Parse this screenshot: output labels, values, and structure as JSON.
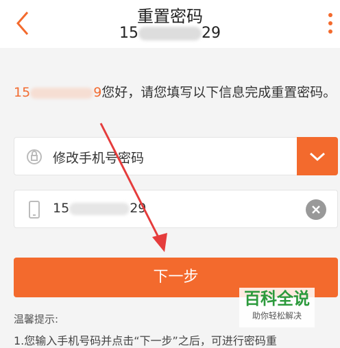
{
  "header": {
    "title": "重置密码",
    "phone_masked": "15 ██████ 29"
  },
  "greeting": {
    "phone_prefix": "15",
    "phone_suffix": "9",
    "text": "您好，请您填写以下信息完成重置密码。"
  },
  "dropdown": {
    "value": "修改手机号密码"
  },
  "phone_input": {
    "value_prefix": "15",
    "value_suffix": "29"
  },
  "next_button": {
    "label": "下一步"
  },
  "tips": {
    "title": "温馨提示:",
    "line1": "1.您输入手机号码并点击“下一步”之后，可进行密码重"
  },
  "watermark": {
    "main": "百科全说",
    "sub": "助你轻松解决"
  },
  "colors": {
    "accent": "#f36a2d",
    "arrow": "#e53c3c"
  }
}
